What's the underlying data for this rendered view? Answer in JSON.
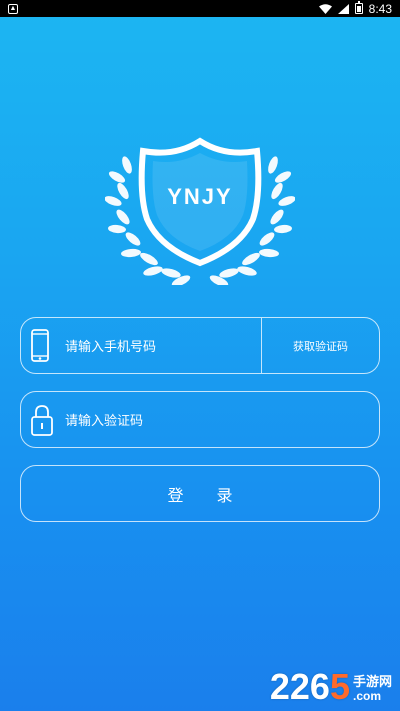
{
  "status_bar": {
    "notification_icon": "notification-icon",
    "wifi_icon": "wifi-icon",
    "signal_icon": "signal-icon",
    "battery_icon": "battery-icon",
    "time": "8:43"
  },
  "logo": {
    "text": "YNJY",
    "shield_icon": "shield-icon",
    "laurel_icon": "laurel-wreath-icon"
  },
  "form": {
    "phone": {
      "icon": "phone-icon",
      "placeholder": "请输入手机号码"
    },
    "get_code_label": "获取验证码",
    "code": {
      "icon": "lock-icon",
      "placeholder": "请输入验证码"
    },
    "login_label": "登 录"
  },
  "watermark": {
    "number_main": "226",
    "number_accent": "5",
    "cn_text": "手游网",
    "domain_text": ".com"
  },
  "colors": {
    "gradient_top": "#1cb6f2",
    "gradient_bottom": "#1a7fec",
    "border": "#ffffff",
    "watermark_accent": "#ff6a2b"
  }
}
